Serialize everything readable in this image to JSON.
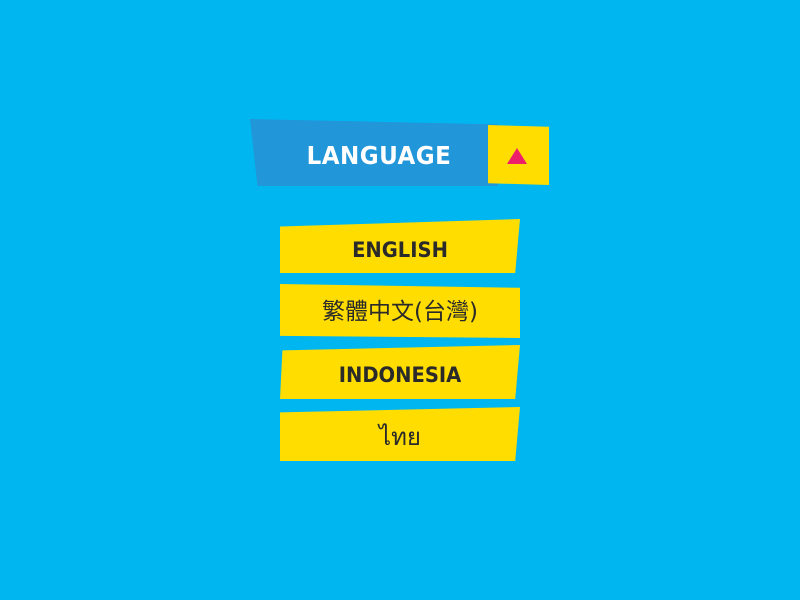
{
  "theme": {
    "background": "#00b6f1",
    "header_bar": "#2196d9",
    "accent_yellow": "#ffdd00",
    "arrow_pink": "#ee1f6a",
    "option_text": "#2a2a2a",
    "header_text": "#ffffff"
  },
  "language_menu": {
    "title": "LANGUAGE",
    "toggle_icon": "triangle-up-icon",
    "options": [
      {
        "label": "ENGLISH"
      },
      {
        "label": "繁體中文(台灣)"
      },
      {
        "label": "INDONESIA"
      },
      {
        "label": "ไทย"
      }
    ]
  }
}
